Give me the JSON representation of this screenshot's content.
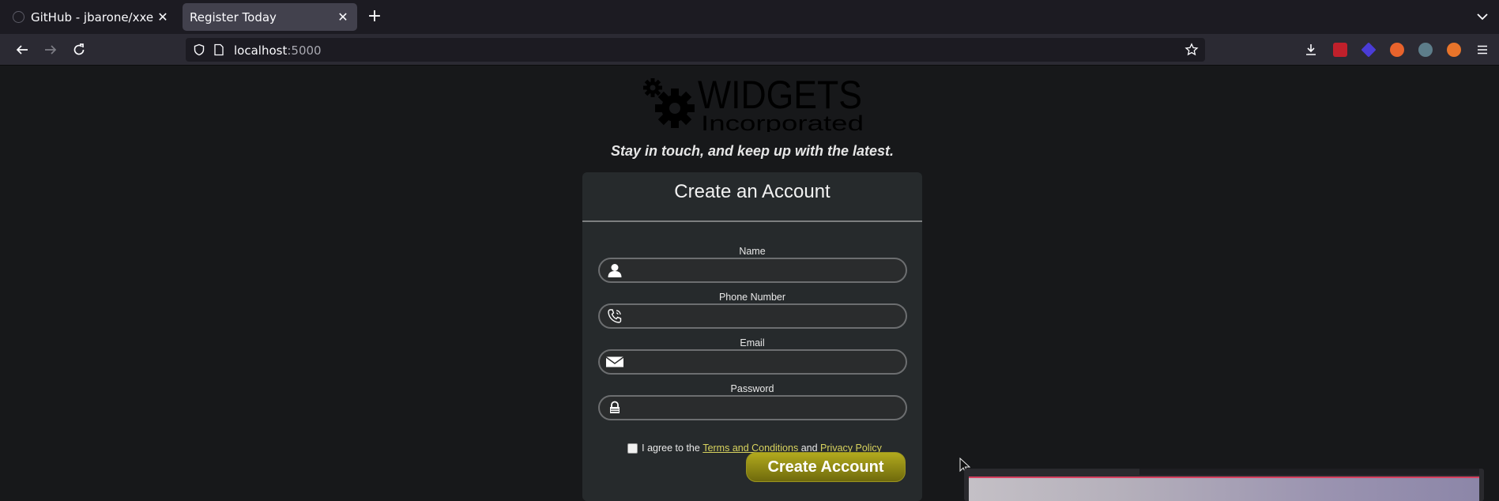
{
  "browser": {
    "tabs": [
      {
        "title": "GitHub - jbarone/xxelab:",
        "active": false
      },
      {
        "title": "Register Today",
        "active": true
      }
    ],
    "url": {
      "host": "localhost",
      "port": ":5000"
    }
  },
  "page": {
    "logo": {
      "line1": "WIDGETS",
      "line2": "Incorporated"
    },
    "tagline": "Stay in touch, and keep up with the latest.",
    "form": {
      "title": "Create an Account",
      "fields": [
        {
          "label": "Name",
          "icon": "person-icon",
          "value": ""
        },
        {
          "label": "Phone Number",
          "icon": "phone-icon",
          "value": ""
        },
        {
          "label": "Email",
          "icon": "envelope-icon",
          "value": ""
        },
        {
          "label": "Password",
          "icon": "lock-icon",
          "value": ""
        }
      ],
      "agree": {
        "prefix": "I agree to the",
        "terms_link": "Terms and Conditions",
        "and": "and",
        "privacy_link": "Privacy Policy"
      },
      "submit_label": "Create Account"
    }
  },
  "colors": {
    "page_bg": "#17181a",
    "card_bg": "#262a2c",
    "button": "#a59d1a",
    "link": "#d8d35e"
  }
}
